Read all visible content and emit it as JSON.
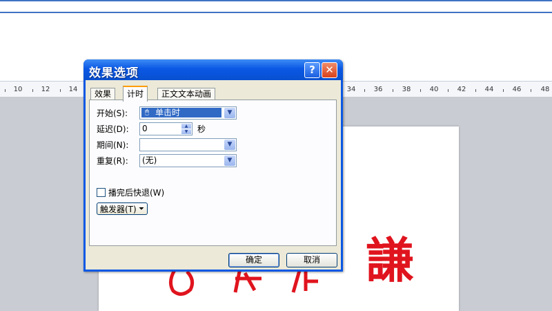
{
  "ruler": {
    "numbers": [
      "10",
      "12",
      "14",
      "34",
      "36",
      "38",
      "40",
      "42",
      "44",
      "46",
      "48"
    ]
  },
  "slide": {
    "seal_chars": [
      "孫",
      "謙"
    ]
  },
  "dialog": {
    "title": "效果选项",
    "help_label": "?",
    "close_label": "✕",
    "tabs": [
      {
        "label": "效果",
        "active": false
      },
      {
        "label": "计时",
        "active": true
      },
      {
        "label": "正文文本动画",
        "active": false
      }
    ],
    "start": {
      "label": "开始(S):",
      "value": "单击时"
    },
    "delay": {
      "label": "延迟(D):",
      "value": "0",
      "unit": "秒"
    },
    "duration": {
      "label": "期间(N):",
      "value": ""
    },
    "repeat": {
      "label": "重复(R):",
      "value": "(无)"
    },
    "rewind": {
      "label": "播完后快退(W)",
      "checked": false
    },
    "trigger_label": "触发器(T)",
    "ok_label": "确定",
    "cancel_label": "取消"
  },
  "colors": {
    "titlebar": "#0a58e4",
    "dialog_bg": "#ece9d8",
    "selection": "#316ac5",
    "seal_red": "#e0141e"
  }
}
